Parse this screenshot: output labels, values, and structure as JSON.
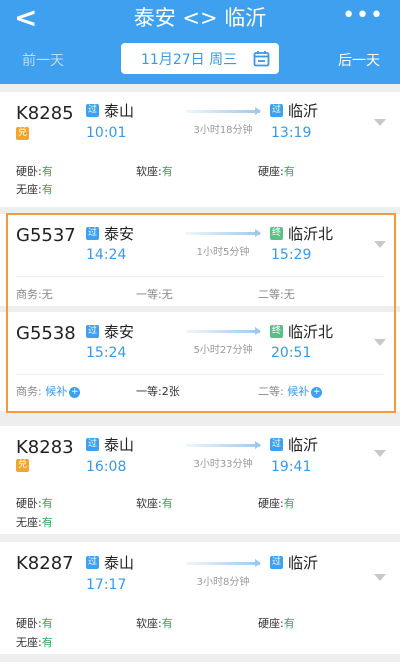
{
  "header": {
    "title": "泰安 <> 临沂",
    "prev_day": "前一天",
    "next_day": "后一天",
    "date": "11月27日 周三"
  },
  "trains": [
    {
      "number": "K8285",
      "tag": "兑",
      "from_badge": "过",
      "from": "泰山",
      "depart": "10:01",
      "to_badge": "过",
      "to": "临沂",
      "arrive": "13:19",
      "duration": "3小时18分钟",
      "seats": [
        {
          "name": "硬卧:",
          "value": "有"
        },
        {
          "name": "软座:",
          "value": "有"
        },
        {
          "name": "硬座:",
          "value": "有"
        },
        {
          "name": "无座:",
          "value": "有"
        }
      ]
    },
    {
      "number": "G5537",
      "from_badge": "过",
      "from": "泰安",
      "depart": "14:24",
      "to_badge": "终",
      "to": "临沂北",
      "arrive": "15:29",
      "duration": "1小时5分钟",
      "seats": [
        {
          "name": "商务:",
          "value": "无"
        },
        {
          "name": "一等:",
          "value": "无"
        },
        {
          "name": "二等:",
          "value": "无"
        }
      ]
    },
    {
      "number": "G5538",
      "from_badge": "过",
      "from": "泰安",
      "depart": "15:24",
      "to_badge": "终",
      "to": "临沂北",
      "arrive": "20:51",
      "duration": "5小时27分钟",
      "seats": [
        {
          "name": "商务:",
          "value": "候补"
        },
        {
          "name": "一等:",
          "value": "2张"
        },
        {
          "name": "二等:",
          "value": "候补"
        }
      ]
    },
    {
      "number": "K8283",
      "tag": "兑",
      "from_badge": "过",
      "from": "泰山",
      "depart": "16:08",
      "to_badge": "过",
      "to": "临沂",
      "arrive": "19:41",
      "duration": "3小时33分钟",
      "seats": [
        {
          "name": "硬卧:",
          "value": "有"
        },
        {
          "name": "软座:",
          "value": "有"
        },
        {
          "name": "硬座:",
          "value": "有"
        },
        {
          "name": "无座:",
          "value": "有"
        }
      ]
    },
    {
      "number": "K8287",
      "from_badge": "过",
      "from": "泰山",
      "depart": "17:17",
      "to_badge": "过",
      "to": "临沂",
      "arrive": "",
      "duration": "3小时8分钟",
      "seats": [
        {
          "name": "硬卧:",
          "value": "有"
        },
        {
          "name": "软座:",
          "value": "有"
        },
        {
          "name": "硬座:",
          "value": "有"
        },
        {
          "name": "无座:",
          "value": "有"
        }
      ]
    }
  ],
  "colors": {
    "header": "#3ea0ee",
    "available": "#3aa05a",
    "time": "#3d98e3",
    "highlight": "#f29a3c"
  }
}
